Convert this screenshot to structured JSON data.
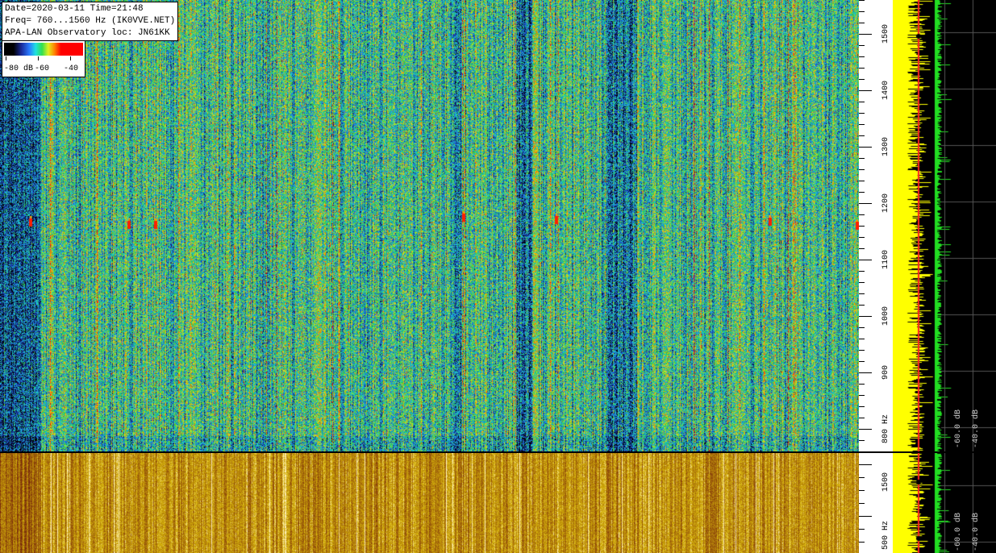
{
  "info": {
    "line1": "Date=2020-03-11 Time=21:48",
    "line2": "Freq= 760...1560 Hz (IK0VVE.NET)",
    "line3": "APA-LAN Observatory loc: JN61KK"
  },
  "color_scale": {
    "label_80": "-80 dB",
    "label_60": "-60",
    "label_40": "-40"
  },
  "freq_axis": {
    "ticks": [
      {
        "label": "1500",
        "value": 1500
      },
      {
        "label": "1400",
        "value": 1400
      },
      {
        "label": "1300",
        "value": 1300
      },
      {
        "label": "1200",
        "value": 1200
      },
      {
        "label": "1100",
        "value": 1100
      },
      {
        "label": "1000",
        "value": 1000
      },
      {
        "label": "900",
        "value": 900
      },
      {
        "label": "800 Hz",
        "value": 800
      }
    ],
    "range_hz": [
      760,
      1560
    ]
  },
  "lower_axis": {
    "label_1500": "1500",
    "label_500": "500 Hz"
  },
  "spectrum_top": {
    "db_60": "-60.0 dB",
    "db_40": "-40.0 dB"
  },
  "spectrum_bottom": {
    "db_60": "-60.0 dB",
    "db_40": "-40.0 dB"
  },
  "colors": {
    "spectrum_yellow": "#ffff00",
    "spectrum_green": "#22dd22",
    "spectrum_red": "#ff2020",
    "grid": "#555555"
  }
}
